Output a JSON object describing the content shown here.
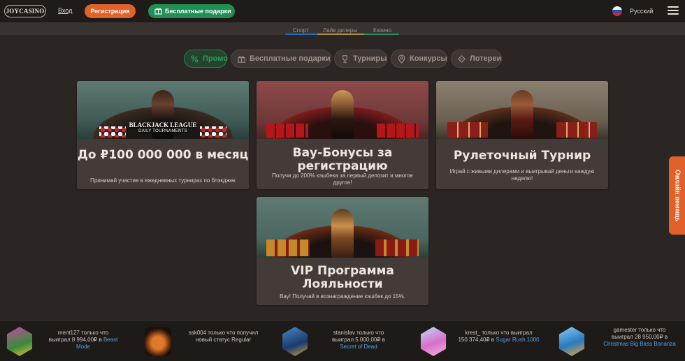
{
  "header": {
    "logo": "JOYCASINO",
    "login": "Вход",
    "register": "Регистрация",
    "gifts": "Бесплатные подарки",
    "language": "Русский"
  },
  "subnav": {
    "items": [
      {
        "label": "Спорт",
        "color": "#1c6fb6"
      },
      {
        "label": "Лайв дилеры",
        "color": "#b38d3a"
      },
      {
        "label": "Казино",
        "color": "#1f8f55"
      }
    ]
  },
  "filters": [
    {
      "label": "Промо",
      "icon": "percent-icon",
      "active": true
    },
    {
      "label": "Бесплатные подарки",
      "icon": "gift-icon",
      "active": false
    },
    {
      "label": "Турниры",
      "icon": "trophy-icon",
      "active": false
    },
    {
      "label": "Конкурсы",
      "icon": "target-icon",
      "active": false
    },
    {
      "label": "Лотереи",
      "icon": "ticket-icon",
      "active": false
    }
  ],
  "cards": [
    {
      "title": "До ₽100 000 000 в месяц",
      "desc": "Принимай участие в ежедневных турнирах по блэкджек",
      "img_label": "BLACKJACK LEAGUE",
      "img_sub": "DAILY TOURNAMENTS"
    },
    {
      "title": "Вау-Бонусы за регистрацию",
      "desc": "Получи до 200% кэшбека за первый депозит и многое другое!"
    },
    {
      "title": "Рулеточный Турнир",
      "desc": "Играй с живыми дилерами и выигрывай деньги каждую неделю!"
    },
    {
      "title": "VIP Программа Лояльности",
      "desc": "Вау! Получай в вознаграждение кэшбек до 15%."
    }
  ],
  "help": "Онлайн помощь",
  "wins": [
    {
      "line1": "ment127 только что",
      "line2": "выиграл 8 994,00₽ в",
      "game": "Beast Mode",
      "thumb": "beast-mode-thumbnail"
    },
    {
      "line1": "ssk004 только что получил",
      "line2": "новый статус Regular",
      "game": "",
      "thumb": "regular-status-thumbnail"
    },
    {
      "line1": "stanislav только что",
      "line2": "выиграл 5 000,00₽ в",
      "game": "Secret of Dead",
      "thumb": "secret-of-dead-thumbnail"
    },
    {
      "line1": "krest_ только что выиграл",
      "line2": "150 374,40₽ в",
      "game": "Sugar Rush 1000",
      "thumb": "sugar-rush-thumbnail"
    },
    {
      "line1": "gamester только что",
      "line2": "выиграл 28 950,00₽ в",
      "game": "Christmas Big Bass Bonanza",
      "thumb": "big-bass-bonanza-thumbnail"
    }
  ]
}
